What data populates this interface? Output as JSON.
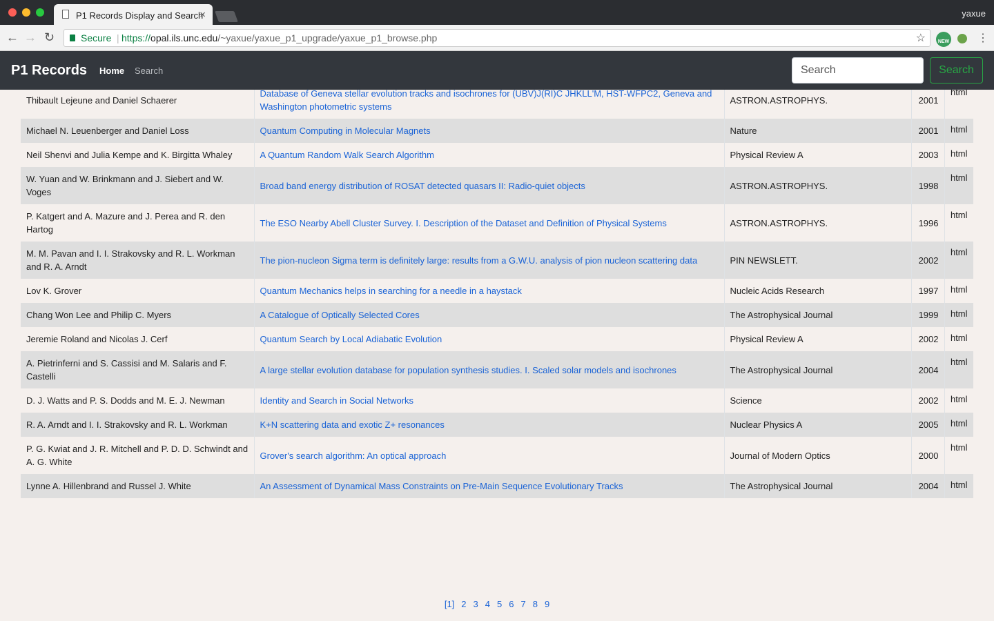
{
  "browser": {
    "tab_title": "P1 Records Display and Search",
    "tab_close": "×",
    "profile_name": "yaxue",
    "secure_label": "Secure",
    "url_scheme": "https://",
    "url_host": "opal.ils.unc.edu",
    "url_path": "/~yaxue/yaxue_p1_upgrade/yaxue_p1_browse.php",
    "ext_label": "NEW"
  },
  "navbar": {
    "brand": "P1 Records",
    "home_label": "Home",
    "search_link": "Search",
    "search_placeholder": "Search",
    "search_button": "Search"
  },
  "records": [
    {
      "author": "Thibault Lejeune and Daniel Schaerer",
      "title": "Database of Geneva stellar evolution tracks and isochrones for (UBV)J(RI)C JHKLL'M, HST-WFPC2, Geneva and Washington photometric systems",
      "journal": "ASTRON.ASTROPHYS.",
      "year": "2001",
      "format": "html"
    },
    {
      "author": "Michael N. Leuenberger and Daniel Loss",
      "title": "Quantum Computing in Molecular Magnets",
      "journal": "Nature",
      "year": "2001",
      "format": "html"
    },
    {
      "author": "Neil Shenvi and Julia Kempe and K. Birgitta Whaley",
      "title": "A Quantum Random Walk Search Algorithm",
      "journal": "Physical Review A",
      "year": "2003",
      "format": "html"
    },
    {
      "author": "W. Yuan and W. Brinkmann and J. Siebert and W. Voges",
      "title": "Broad band energy distribution of ROSAT detected quasars II: Radio-quiet objects",
      "journal": "ASTRON.ASTROPHYS.",
      "year": "1998",
      "format": "html"
    },
    {
      "author": "P. Katgert and A. Mazure and J. Perea and R. den Hartog",
      "title": "The ESO Nearby Abell Cluster Survey. I. Description of the Dataset and Definition of Physical Systems",
      "journal": "ASTRON.ASTROPHYS.",
      "year": "1996",
      "format": "html"
    },
    {
      "author": "M. M. Pavan and I. I. Strakovsky and R. L. Workman and R. A. Arndt",
      "title": "The pion-nucleon Sigma term is definitely large: results from a G.W.U. analysis of pion nucleon scattering data",
      "journal": "PIN NEWSLETT.",
      "year": "2002",
      "format": "html"
    },
    {
      "author": "Lov K. Grover",
      "title": "Quantum Mechanics helps in searching for a needle in a haystack",
      "journal": "Nucleic Acids Research",
      "year": "1997",
      "format": "html"
    },
    {
      "author": "Chang Won Lee and Philip C. Myers",
      "title": "A Catalogue of Optically Selected Cores",
      "journal": "The Astrophysical Journal",
      "year": "1999",
      "format": "html"
    },
    {
      "author": "Jeremie Roland and Nicolas J. Cerf",
      "title": "Quantum Search by Local Adiabatic Evolution",
      "journal": "Physical Review A",
      "year": "2002",
      "format": "html"
    },
    {
      "author": "A. Pietrinferni and S. Cassisi and M. Salaris and F. Castelli",
      "title": "A large stellar evolution database for population synthesis studies. I. Scaled solar models and isochrones",
      "journal": "The Astrophysical Journal",
      "year": "2004",
      "format": "html"
    },
    {
      "author": "D. J. Watts and P. S. Dodds and M. E. J. Newman",
      "title": "Identity and Search in Social Networks",
      "journal": "Science",
      "year": "2002",
      "format": "html"
    },
    {
      "author": "R. A. Arndt and I. I. Strakovsky and R. L. Workman",
      "title": "K+N scattering data and exotic Z+ resonances",
      "journal": "Nuclear Physics A",
      "year": "2005",
      "format": "html"
    },
    {
      "author": "P. G. Kwiat and J. R. Mitchell and P. D. D. Schwindt and A. G. White",
      "title": "Grover's search algorithm: An optical approach",
      "journal": "Journal of Modern Optics",
      "year": "2000",
      "format": "html"
    },
    {
      "author": "Lynne A. Hillenbrand and Russel J. White",
      "title": "An Assessment of Dynamical Mass Constraints on Pre-Main Sequence Evolutionary Tracks",
      "journal": "The Astrophysical Journal",
      "year": "2004",
      "format": "html"
    }
  ],
  "pagination": [
    "[1]",
    "2",
    "3",
    "4",
    "5",
    "6",
    "7",
    "8",
    "9"
  ]
}
